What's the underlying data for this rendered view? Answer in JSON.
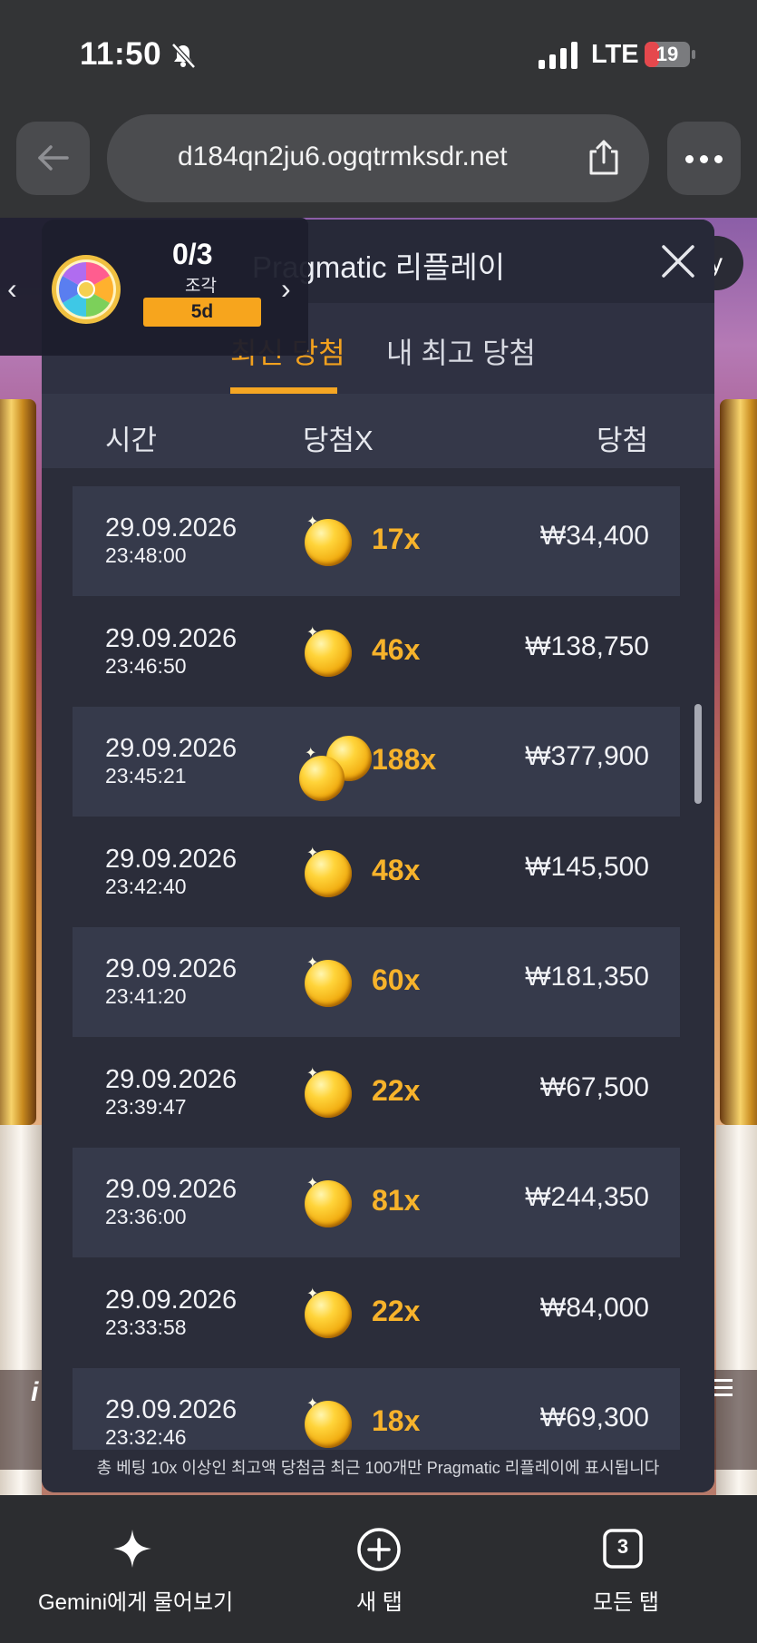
{
  "status_bar": {
    "time": "11:50",
    "network": "LTE",
    "battery": "19",
    "battery_color": "#e5484d"
  },
  "browser": {
    "url": "d184qn2ju6.ogqtrmksdr.net"
  },
  "piece_widget": {
    "count": "0/3",
    "label": "조각",
    "badge": "5d"
  },
  "game": {
    "bottom_letter": "i",
    "top_right_letter": "y"
  },
  "modal": {
    "title": "Pragmatic 리플레이",
    "tabs": [
      {
        "label": "최신 당첨",
        "active": true
      },
      {
        "label": "내 최고 당첨",
        "active": false
      }
    ],
    "columns": {
      "time": "시간",
      "multiplier": "당첨X",
      "win": "당첨"
    },
    "rows": [
      {
        "date": "29.09.2026",
        "time": "23:48:00",
        "multiplier": "17x",
        "win": "₩34,400",
        "coins": 1
      },
      {
        "date": "29.09.2026",
        "time": "23:46:50",
        "multiplier": "46x",
        "win": "₩138,750",
        "coins": 1
      },
      {
        "date": "29.09.2026",
        "time": "23:45:21",
        "multiplier": "188x",
        "win": "₩377,900",
        "coins": 2
      },
      {
        "date": "29.09.2026",
        "time": "23:42:40",
        "multiplier": "48x",
        "win": "₩145,500",
        "coins": 1
      },
      {
        "date": "29.09.2026",
        "time": "23:41:20",
        "multiplier": "60x",
        "win": "₩181,350",
        "coins": 1
      },
      {
        "date": "29.09.2026",
        "time": "23:39:47",
        "multiplier": "22x",
        "win": "₩67,500",
        "coins": 1
      },
      {
        "date": "29.09.2026",
        "time": "23:36:00",
        "multiplier": "81x",
        "win": "₩244,350",
        "coins": 1
      },
      {
        "date": "29.09.2026",
        "time": "23:33:58",
        "multiplier": "22x",
        "win": "₩84,000",
        "coins": 1
      },
      {
        "date": "29.09.2026",
        "time": "23:32:46",
        "multiplier": "18x",
        "win": "₩69,300",
        "coins": 1
      }
    ],
    "footer_note": "총 베팅 10x 이상인 최고액 당첨금 최근 100개만 Pragmatic 리플레이에 표시됩니다",
    "accent_color": "#f5a623"
  },
  "bottom_bar": {
    "gemini_label": "Gemini에게 물어보기",
    "new_tab_label": "새 탭",
    "all_tabs_label": "모든 탭",
    "tab_count": "3"
  }
}
